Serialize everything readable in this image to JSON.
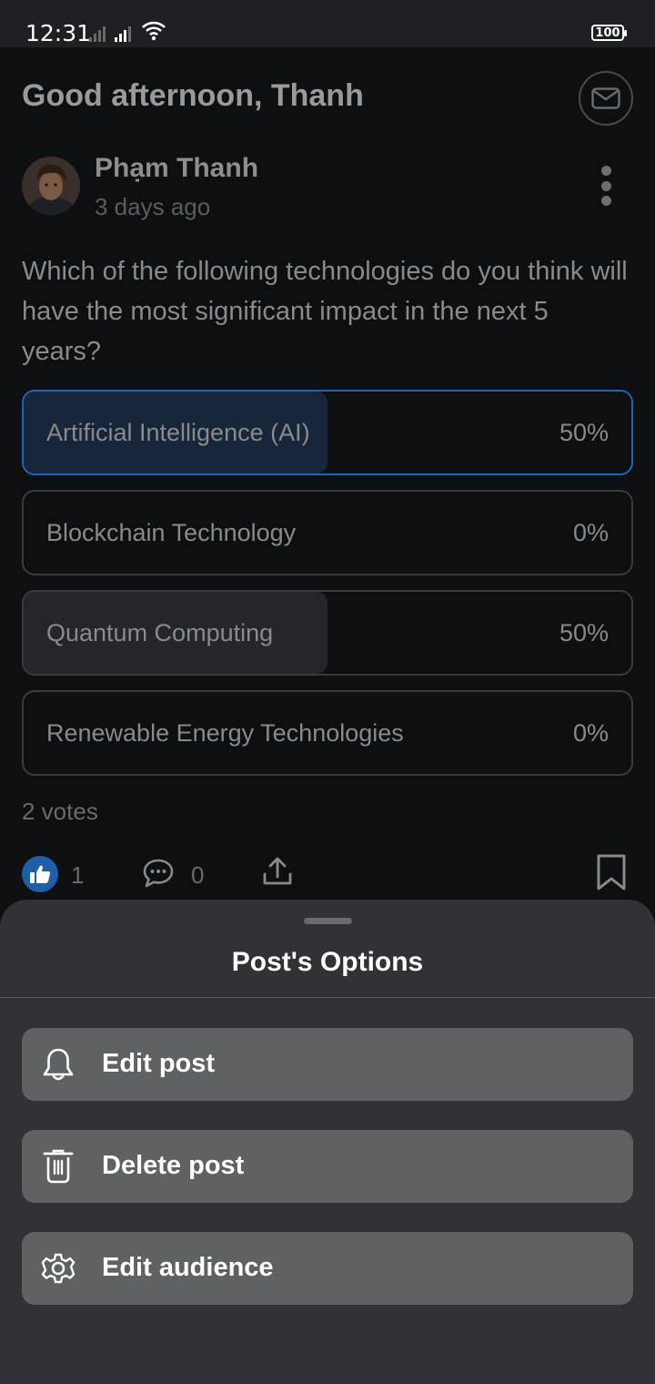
{
  "status_bar": {
    "time": "12:31",
    "battery": "100"
  },
  "header": {
    "greeting": "Good afternoon, Thanh",
    "mail_icon": "mail-icon"
  },
  "post": {
    "author": "Phạm Thanh",
    "time": "3 days ago",
    "question": "Which of the following technologies do you think will have the most significant impact in the next 5 years?",
    "options": [
      {
        "label": "Artificial Intelligence (AI)",
        "percent_label": "50%",
        "fraction": 0.5,
        "selected": true
      },
      {
        "label": "Blockchain Technology",
        "percent_label": "0%",
        "fraction": 0,
        "selected": false
      },
      {
        "label": "Quantum Computing",
        "percent_label": "50%",
        "fraction": 0.5,
        "selected": false
      },
      {
        "label": "Renewable Energy Technologies",
        "percent_label": "0%",
        "fraction": 0,
        "selected": false
      }
    ],
    "votes": "2 votes",
    "actions": {
      "likes": "1",
      "comments": "0"
    }
  },
  "sheet": {
    "title": "Post's Options",
    "items": [
      {
        "label": "Edit post",
        "icon": "bell-icon"
      },
      {
        "label": "Delete post",
        "icon": "trash-icon"
      },
      {
        "label": "Edit audience",
        "icon": "gear-icon"
      }
    ]
  },
  "colors": {
    "selected_border": "#1e64b8",
    "like_blue": "#1f5faa",
    "sheet_bg": "#313235",
    "menu_item_bg": "#606163"
  }
}
